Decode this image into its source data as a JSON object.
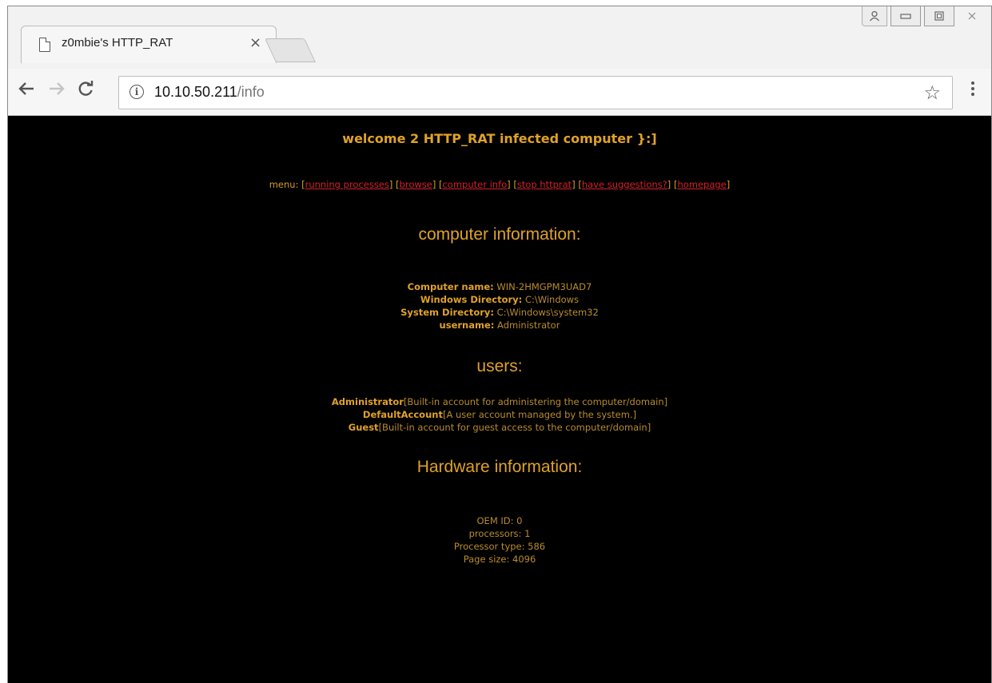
{
  "browser": {
    "tab_title": "z0mbie's HTTP_RAT",
    "tab_close": "×",
    "url_host": "10.10.50.211",
    "url_path": "/info",
    "icons": {
      "back": "arrow-left",
      "forward": "arrow-right",
      "reload": "reload",
      "info": "info-circle",
      "star": "star-outline",
      "menu": "vertical-dots",
      "profile": "person",
      "minimize": "minimize",
      "maximize": "maximize",
      "close": "close"
    }
  },
  "page": {
    "welcome": "welcome 2 HTTP_RAT infected computer }:]",
    "menu_label": "menu: ",
    "menu_items": [
      "running processes",
      "browse",
      "computer info",
      "stop httprat",
      "have suggestions?",
      "homepage"
    ],
    "computer_info_title": "computer information:",
    "computer_info": [
      {
        "key": "Computer name:",
        "value": "WIN-2HMGPM3UAD7"
      },
      {
        "key": "Windows Directory:",
        "value": "C:\\Windows"
      },
      {
        "key": "System Directory:",
        "value": "C:\\Windows\\system32"
      },
      {
        "key": "username:",
        "value": "Administrator"
      }
    ],
    "users_title": "users:",
    "users": [
      {
        "name": "Administrator",
        "desc": "[Built-in account for administering the computer/domain]"
      },
      {
        "name": "DefaultAccount",
        "desc": "[A user account managed by the system.]"
      },
      {
        "name": "Guest",
        "desc": "[Built-in account for guest access to the computer/domain]"
      }
    ],
    "hardware_title": "Hardware information:",
    "hardware": [
      "OEM ID: 0",
      "processors: 1",
      "Processor type: 586",
      "Page size: 4096"
    ]
  },
  "colors": {
    "page_bg": "#000000",
    "text_gold": "#e0a228",
    "link_red": "#d4202a"
  }
}
